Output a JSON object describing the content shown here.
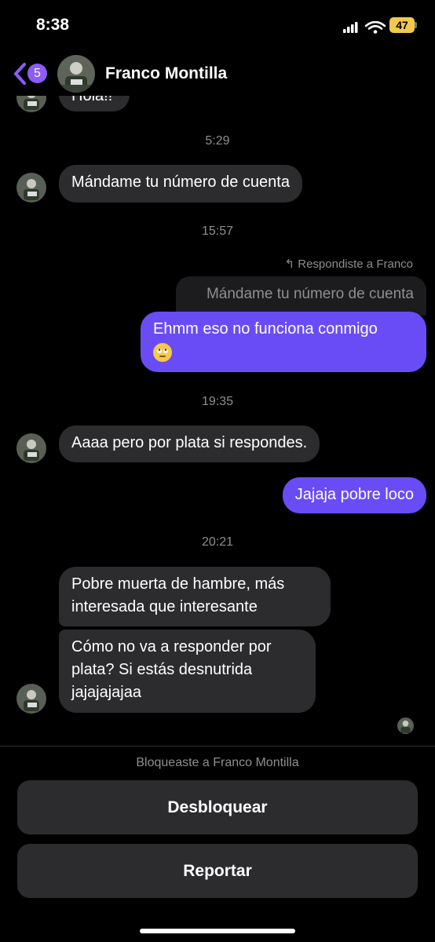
{
  "status_bar": {
    "time": "8:38",
    "battery": "47"
  },
  "header": {
    "unread_count": "5",
    "contact_name": "Franco Montilla"
  },
  "messages": {
    "partial_top": "Hola!!",
    "ts1": "5:29",
    "m1": "Mándame tu número de cuenta",
    "ts2": "15:57",
    "reply_label": "Respondiste a Franco",
    "quoted_text": "Mándame tu número de cuenta",
    "out1": "Ehmm eso no funciona conmigo",
    "out1_emoji": "face-with-rolling-eyes",
    "ts3": "19:35",
    "m2": "Aaaa pero por plata si respondes.",
    "out2": "Jajaja pobre loco",
    "ts4": "20:21",
    "m3_line1": "Pobre muerta de hambre, más",
    "m3_line2": "interesada que interesante",
    "m4_line1": "Cómo no va a responder por",
    "m4_line2": "plata? Si estás desnutrida",
    "m4_line3": "jajajajajaa"
  },
  "footer": {
    "blocked_notice": "Bloqueaste a Franco Montilla",
    "unblock_label": "Desbloquear",
    "report_label": "Reportar"
  },
  "colors": {
    "accent": "#6a4cf7",
    "badge": "#8b5cf6",
    "bubble_in": "#2c2c2e",
    "battery": "#f2c94c"
  }
}
